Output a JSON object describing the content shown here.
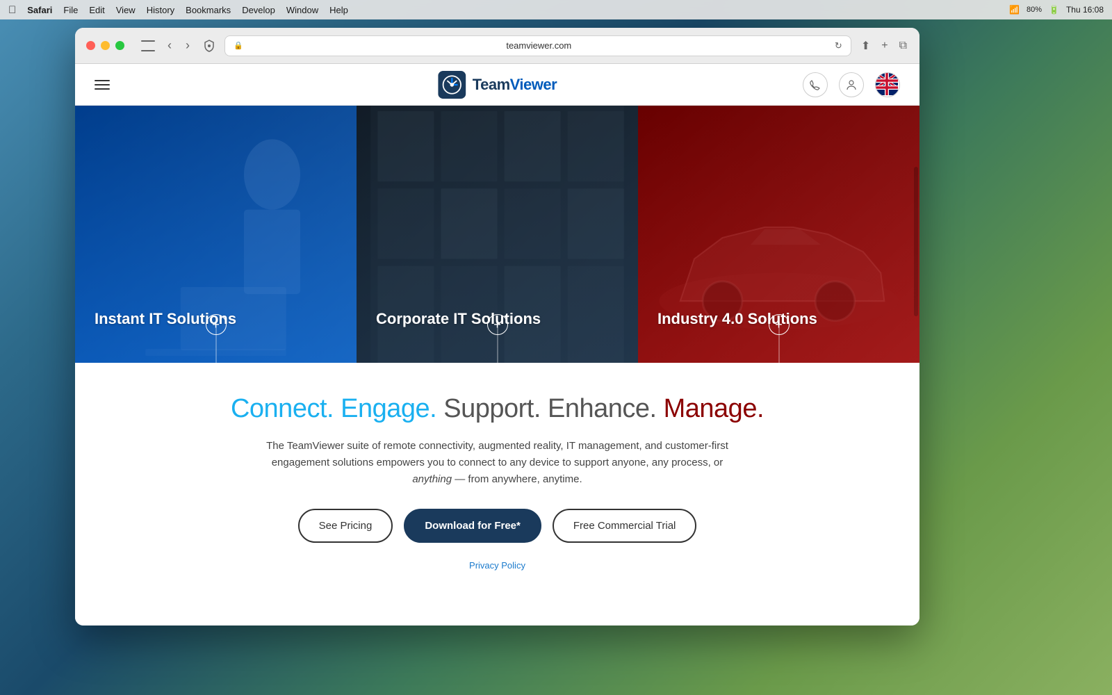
{
  "desktop": {
    "bg_color": "#5a8aaa"
  },
  "menubar": {
    "apple": "⌘",
    "app": "Safari",
    "items": [
      "File",
      "Edit",
      "View",
      "History",
      "Bookmarks",
      "Develop",
      "Window",
      "Help"
    ],
    "time": "Thu 16:08",
    "battery": "80%"
  },
  "browser": {
    "url": "teamviewer.com",
    "back_btn": "‹",
    "forward_btn": "›"
  },
  "header": {
    "logo_text_team": "Team",
    "logo_text_viewer": "Viewer",
    "menu_label": "Menu"
  },
  "solution_cards": [
    {
      "id": "instant",
      "title": "Instant IT Solutions",
      "color": "blue"
    },
    {
      "id": "corporate",
      "title": "Corporate IT Solutions",
      "color": "dark"
    },
    {
      "id": "industry",
      "title": "Industry 4.0 Solutions",
      "color": "red"
    }
  ],
  "tagline": {
    "connect": "Connect.",
    "engage": "Engage.",
    "support": "Support.",
    "enhance": "Enhance.",
    "manage": "Manage."
  },
  "description": {
    "text_before": "The TeamViewer suite of remote connectivity, augmented reality, IT management, and customer-first engagement solutions empowers you to connect to any device to support anyone, any process, or ",
    "italic": "anything",
    "text_after": " — from anywhere, anytime."
  },
  "buttons": {
    "see_pricing": "See Pricing",
    "download": "Download for Free*",
    "free_trial": "Free Commercial Trial"
  },
  "footer": {
    "privacy_policy": "Privacy Policy"
  }
}
